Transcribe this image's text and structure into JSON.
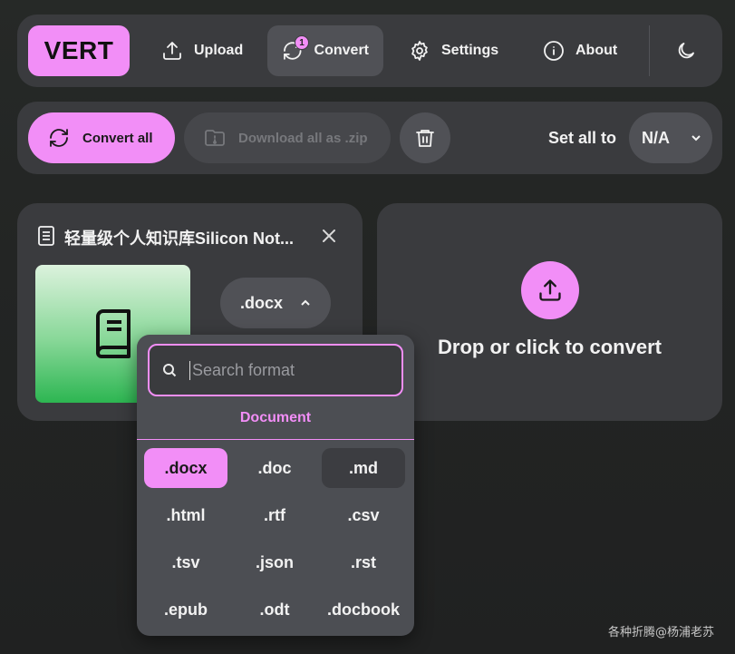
{
  "nav": {
    "logo": "VERT",
    "items": [
      {
        "label": "Upload",
        "icon": "upload-icon"
      },
      {
        "label": "Convert",
        "icon": "convert-icon",
        "badge": "1",
        "active": true
      },
      {
        "label": "Settings",
        "icon": "gear-icon"
      },
      {
        "label": "About",
        "icon": "info-icon"
      }
    ],
    "theme_icon": "moon-icon"
  },
  "toolbar": {
    "convert_all": "Convert all",
    "download_zip": "Download all as .zip",
    "set_all_label": "Set all to",
    "set_all_value": "N/A"
  },
  "file": {
    "name": "轻量级个人知识库Silicon Not...",
    "format": ".docx",
    "thumbnail_icon": "book-icon"
  },
  "dropzone": {
    "text": "Drop or click to convert"
  },
  "format_dropdown": {
    "search_placeholder": "Search format",
    "category": "Document",
    "formats": [
      ".docx",
      ".doc",
      ".md",
      ".html",
      ".rtf",
      ".csv",
      ".tsv",
      ".json",
      ".rst",
      ".epub",
      ".odt",
      ".docbook"
    ],
    "selected": ".docx",
    "hovered": ".md"
  },
  "colors": {
    "accent": "#f28ef7",
    "panel": "#3a3b3e",
    "button": "#505156",
    "dropdown": "#4c4e53"
  },
  "watermark": "各种折腾@杨浦老苏"
}
